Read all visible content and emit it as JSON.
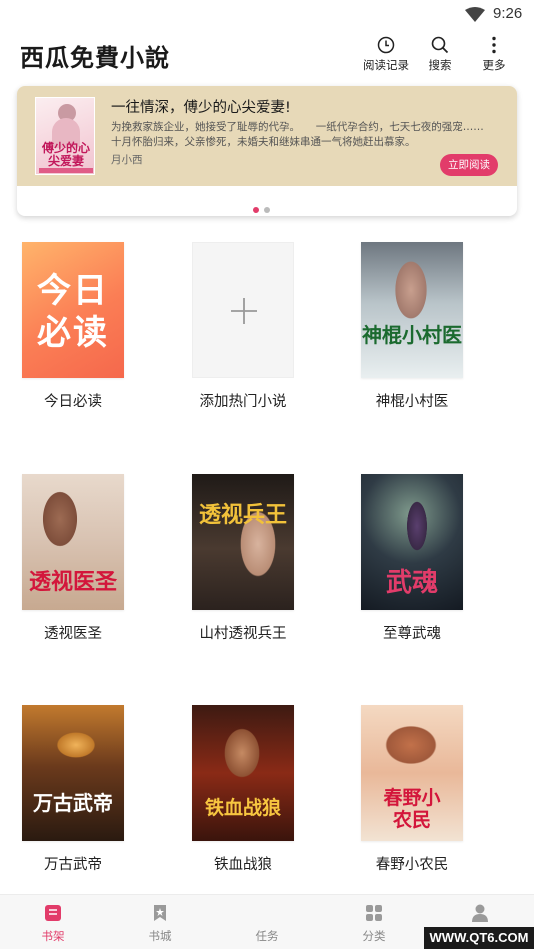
{
  "status_bar": {
    "time": "9:26",
    "signal_icon": "wifi-icon"
  },
  "app": {
    "title": "西瓜免費小說"
  },
  "top_actions": [
    {
      "icon": "clock-icon",
      "label": "阅读记录"
    },
    {
      "icon": "search-icon",
      "label": "搜索"
    },
    {
      "icon": "more-vertical-icon",
      "label": "更多"
    }
  ],
  "banner": {
    "title": "一往情深，傅少的心尖爱妻!",
    "description": "为挽救家族企业，她接受了耻辱的代孕。　　一纸代孕合约，七天七夜的强宠……　　十月怀胎归来，父亲惨死，未婚夫和继妹串通一气将她赶出慕家。",
    "author": "月小西",
    "button": "立即阅读",
    "cover_title": "傅少的心尖爱妻",
    "active_dot": 0,
    "dot_count": 2
  },
  "books": [
    {
      "title": "今日必读",
      "cover_text": "今日必读"
    },
    {
      "title": "添加热门小说",
      "cover_text": "+"
    },
    {
      "title": "神棍小村医",
      "cover_text": "神棍小村医"
    },
    {
      "title": "透视医圣",
      "cover_text": "透视医圣"
    },
    {
      "title": "山村透视兵王",
      "cover_text": "透视兵王"
    },
    {
      "title": "至尊武魂",
      "cover_text": "武魂"
    },
    {
      "title": "万古武帝",
      "cover_text": "万古武帝"
    },
    {
      "title": "铁血战狼",
      "cover_text": "铁血战狼"
    },
    {
      "title": "春野小农民",
      "cover_text": "春野小农民"
    }
  ],
  "tabs": [
    {
      "icon": "bookshelf-icon",
      "label": "书架",
      "active": true
    },
    {
      "icon": "bookmark-icon",
      "label": "书城",
      "active": false
    },
    {
      "icon": "task-icon",
      "label": "任务",
      "active": false
    },
    {
      "icon": "category-grid-icon",
      "label": "分类",
      "active": false
    },
    {
      "icon": "user-icon",
      "label": "我的",
      "active": false
    }
  ],
  "watermark": "WWW.QT6.COM",
  "colors": {
    "accent": "#e23c6a",
    "banner_bg": "#e7d9b8",
    "tab_inactive": "#888888",
    "dot_inactive": "#bbbbbb"
  }
}
